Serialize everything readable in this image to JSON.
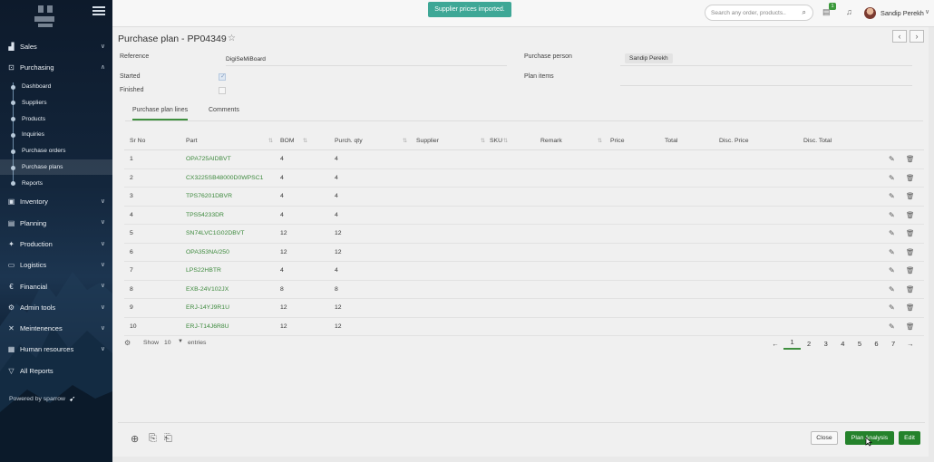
{
  "sidebar": {
    "nav": [
      {
        "label": "Sales",
        "icon": "sales-icon",
        "glyph": "▟"
      },
      {
        "label": "Purchasing",
        "icon": "cart-icon",
        "glyph": "⊡"
      }
    ],
    "purchasing_items": [
      "Dashboard",
      "Suppliers",
      "Products",
      "Inquiries",
      "Purchase orders",
      "Purchase plans",
      "Reports"
    ],
    "nav2": [
      {
        "label": "Inventory",
        "glyph": "▣"
      },
      {
        "label": "Planning",
        "glyph": "▤"
      },
      {
        "label": "Production",
        "glyph": "✦"
      },
      {
        "label": "Logistics",
        "glyph": "▭"
      },
      {
        "label": "Financial",
        "glyph": "€"
      },
      {
        "label": "Admin tools",
        "glyph": "⚙"
      },
      {
        "label": "Meintenences",
        "glyph": "✕"
      },
      {
        "label": "Human resources",
        "glyph": "▦"
      },
      {
        "label": "All Reports",
        "glyph": "▽"
      }
    ],
    "powered": "Powered by sparrow"
  },
  "topbar": {
    "toast": "Supplier prices imported.",
    "search_placeholder": "Search any order, products..",
    "badge": "1",
    "username": "Sandip Perekh"
  },
  "page": {
    "title": "Purchase plan - PP04349",
    "fields": {
      "reference_label": "Reference",
      "reference_value": "DigiSeMiBoard",
      "started_label": "Started",
      "finished_label": "Finished",
      "person_label": "Purchase person",
      "person_value": "Sandip Perekh",
      "items_label": "Plan items"
    },
    "tabs": [
      "Purchase plan lines",
      "Comments"
    ]
  },
  "table": {
    "headers": [
      "Sr No",
      "Part",
      "BOM",
      "Purch. qty",
      "Supplier",
      "SKU",
      "Remark",
      "Price",
      "Total",
      "Disc. Price",
      "Disc. Total"
    ],
    "rows": [
      [
        "1",
        "OPA725AIDBVT",
        "4",
        "4"
      ],
      [
        "2",
        "CX3225SB48000D0WPSC1",
        "4",
        "4"
      ],
      [
        "3",
        "TPS76201DBVR",
        "4",
        "4"
      ],
      [
        "4",
        "TPS54233DR",
        "4",
        "4"
      ],
      [
        "5",
        "SN74LVC1G02DBVT",
        "12",
        "12"
      ],
      [
        "6",
        "OPA353NA/250",
        "12",
        "12"
      ],
      [
        "7",
        "LPS22HBTR",
        "4",
        "4"
      ],
      [
        "8",
        "EXB-24V102JX",
        "8",
        "8"
      ],
      [
        "9",
        "ERJ-14YJ9R1U",
        "12",
        "12"
      ],
      [
        "10",
        "ERJ-T14J6R8U",
        "12",
        "12"
      ]
    ],
    "show_label": "Show",
    "show_value": "10",
    "entries_label": "entries",
    "pages": [
      "1",
      "2",
      "3",
      "4",
      "5",
      "6",
      "7"
    ],
    "prev": "←",
    "next": "→"
  },
  "actions": {
    "close": "Close",
    "plan_analysis": "Plan Analysis",
    "edit": "Edit"
  },
  "colors": {
    "accent": "#24822b",
    "link": "#3e8a3e",
    "toast": "#3ea796"
  }
}
